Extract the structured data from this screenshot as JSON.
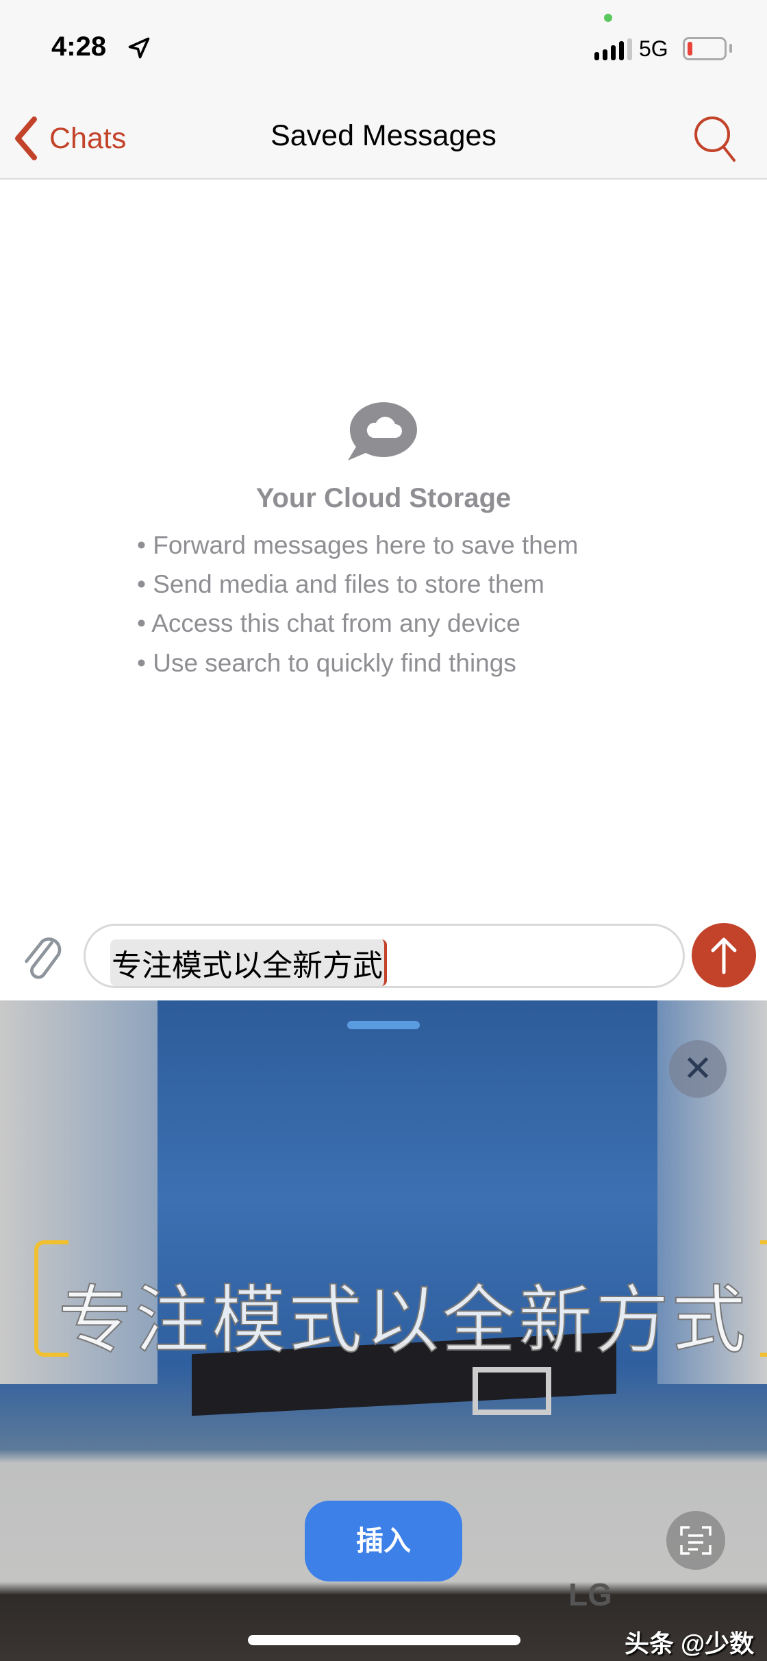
{
  "status_bar": {
    "time": "4:28",
    "network": "5G",
    "battery_level": 0.1,
    "signal_bars": "4 of 5",
    "icons": [
      "location-arrow-icon",
      "signal-icon",
      "battery-icon"
    ]
  },
  "nav": {
    "back_label": "Chats",
    "title": "Saved Messages",
    "search_icon": "search-icon",
    "accent": "#c2432a"
  },
  "empty_state": {
    "icon": "cloud-bubble-icon",
    "title": "Your Cloud Storage",
    "bullets": [
      "• Forward messages here to save them",
      "• Send media and files to store them",
      "• Access this chat from any device",
      "• Use search to quickly find things"
    ]
  },
  "composer": {
    "value": "专注模式以全新方武",
    "attach_icon": "paperclip-icon",
    "send_icon": "arrow-up-icon"
  },
  "live_text": {
    "recognized_text": "专注模式以全新方式",
    "insert_label": "插入",
    "close_icon": "close-icon",
    "scan_icon": "text-scan-icon",
    "insert_color": "#3d80e8"
  },
  "watermark": "头条 @少数派",
  "logo_text": "LG"
}
